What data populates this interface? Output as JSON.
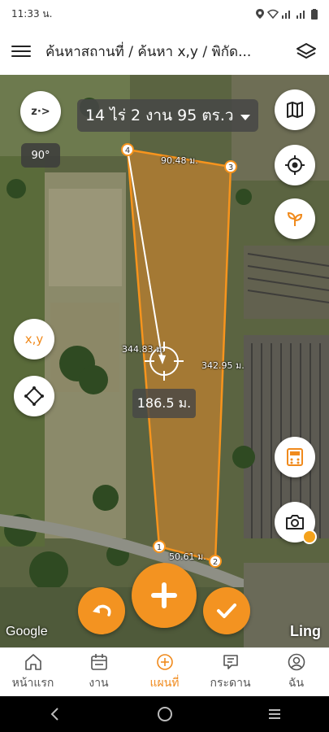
{
  "status_bar": {
    "time": "11:33 น."
  },
  "header": {
    "title": "ค้นหาสถานที่ / ค้นหา x,y / พิกัด..."
  },
  "map": {
    "area_text": "14 ไร่ 2 งาน 95 ตร.ว",
    "zoom_label": "z·>",
    "angle": "90°",
    "xy_label": "x,y",
    "measurement": "186.5 ม.",
    "distances": {
      "top": "90.48 ม.",
      "right": "342.95 ม.",
      "bottom": "50.61 ม.",
      "diagonal": "344.83 ม."
    },
    "vertices": [
      "1",
      "2",
      "3",
      "4"
    ],
    "google_attribution": "Google",
    "brand": "Ling"
  },
  "bottom_nav": [
    {
      "label": "หน้าแรก",
      "icon": "home-icon",
      "active": false
    },
    {
      "label": "งาน",
      "icon": "calendar-icon",
      "active": false
    },
    {
      "label": "แผนที่",
      "icon": "add-circle-icon",
      "active": true
    },
    {
      "label": "กระดาน",
      "icon": "board-icon",
      "active": false
    },
    {
      "label": "ฉัน",
      "icon": "profile-icon",
      "active": false
    }
  ],
  "colors": {
    "accent": "#f39321",
    "polygon_fill": "#e08a2a",
    "polygon_stroke": "#f7941d"
  }
}
